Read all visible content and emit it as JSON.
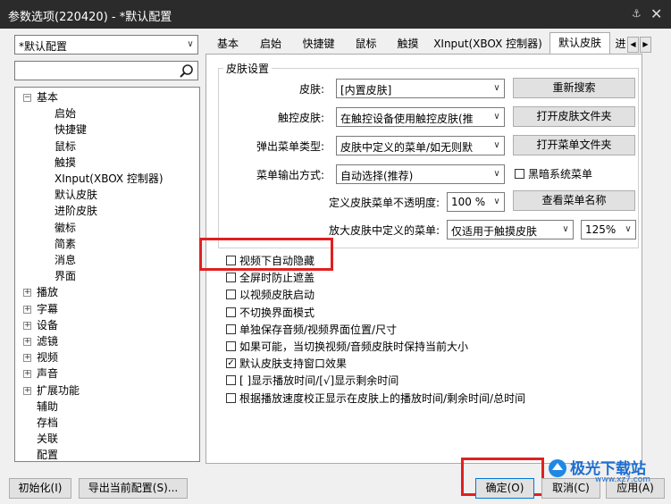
{
  "window": {
    "title": "参数选项(220420) - *默认配置",
    "pin_icon": "pin-icon",
    "close_icon": "close-icon"
  },
  "profile_select": {
    "value": "*默认配置"
  },
  "search": {
    "placeholder": "",
    "icon": "search-icon"
  },
  "tree": {
    "items": [
      {
        "label": "基本",
        "expander": "−"
      },
      {
        "label": "启始"
      },
      {
        "label": "快捷键"
      },
      {
        "label": "鼠标"
      },
      {
        "label": "触摸"
      },
      {
        "label": "XInput(XBOX 控制器)"
      },
      {
        "label": "默认皮肤"
      },
      {
        "label": "进阶皮肤"
      },
      {
        "label": "徽标"
      },
      {
        "label": "简素"
      },
      {
        "label": "消息"
      },
      {
        "label": "界面"
      },
      {
        "label": "播放",
        "expander": "+"
      },
      {
        "label": "字幕",
        "expander": "+"
      },
      {
        "label": "设备",
        "expander": "+"
      },
      {
        "label": "滤镜",
        "expander": "+"
      },
      {
        "label": "视频",
        "expander": "+"
      },
      {
        "label": "声音",
        "expander": "+"
      },
      {
        "label": "扩展功能",
        "expander": "+"
      },
      {
        "label": "辅助"
      },
      {
        "label": "存档"
      },
      {
        "label": "关联"
      },
      {
        "label": "配置"
      }
    ]
  },
  "tabs": [
    {
      "label": "基本"
    },
    {
      "label": "启始"
    },
    {
      "label": "快捷键"
    },
    {
      "label": "鼠标"
    },
    {
      "label": "触摸"
    },
    {
      "label": "XInput(XBOX 控制器)"
    },
    {
      "label": "默认皮肤"
    },
    {
      "label": "进"
    }
  ],
  "tab_scroll": {
    "left": "◀",
    "right": "▶"
  },
  "skin_group": {
    "title": "皮肤设置",
    "skin_label": "皮肤:",
    "skin_value": "[内置皮肤]",
    "rescan_button": "重新搜索",
    "touch_skin_label": "触控皮肤:",
    "touch_skin_value": "在触控设备使用触控皮肤(推",
    "open_skin_folder_button": "打开皮肤文件夹",
    "popup_menu_label": "弹出菜单类型:",
    "popup_menu_value": "皮肤中定义的菜单/如无则默",
    "open_menu_folder_button": "打开菜单文件夹",
    "menu_output_label": "菜单输出方式:",
    "menu_output_value": "自动选择(推荐)",
    "dark_system_menu": "黑暗系统菜单",
    "opacity_label": "定义皮肤菜单不透明度:",
    "opacity_value": "100 %",
    "view_menu_name_button": "查看菜单名称",
    "enlarge_label": "放大皮肤中定义的菜单:",
    "enlarge_value": "仅适用于触摸皮肤",
    "enlarge_pct": "125%"
  },
  "options": [
    {
      "label": "视频下自动隐藏",
      "checked": false
    },
    {
      "label": "全屏时防止遮盖",
      "checked": false
    },
    {
      "label": "以视频皮肤启动",
      "checked": false
    },
    {
      "label": "不切换界面模式",
      "checked": false
    },
    {
      "label": "单独保存音频/视频界面位置/尺寸",
      "checked": false
    },
    {
      "label": "如果可能，当切换视频/音频皮肤时保持当前大小",
      "checked": false
    },
    {
      "label": "默认皮肤支持窗口效果",
      "checked": true
    },
    {
      "label": "[ ]显示播放时间/[√]显示剩余时间",
      "checked": false
    },
    {
      "label": "根据播放速度校正显示在皮肤上的播放时间/剩余时间/总时间",
      "checked": false
    }
  ],
  "footer": {
    "init_button": "初始化(I)",
    "export_button": "导出当前配置(S)...",
    "ok_button": "确定(O)",
    "cancel_button": "取消(C)",
    "apply_button": "应用(A)"
  },
  "watermark": {
    "text": "极光下载站",
    "url_text": "www.xz7.com"
  },
  "colors": {
    "highlight": "#e02020",
    "titlebar": "#2b2b2b"
  }
}
